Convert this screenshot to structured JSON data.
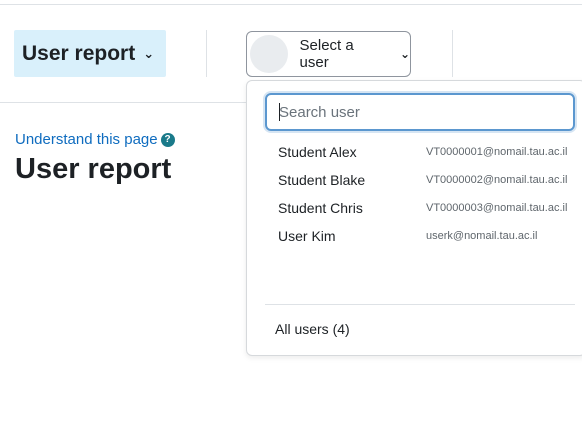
{
  "header": {
    "report_selector_label": "User report",
    "user_selector_label": "Select a user"
  },
  "help": {
    "link_text": "Understand this page",
    "icon": "question-circle-icon"
  },
  "page_title": "User report",
  "user_dropdown": {
    "search_placeholder": "Search user",
    "users": [
      {
        "name": "Student Alex",
        "email": "VT0000001@nomail.tau.ac.il"
      },
      {
        "name": "Student Blake",
        "email": "VT0000002@nomail.tau.ac.il"
      },
      {
        "name": "Student Chris",
        "email": "VT0000003@nomail.tau.ac.il"
      },
      {
        "name": "User Kim",
        "email": "userk@nomail.tau.ac.il"
      }
    ],
    "all_users_label": "All users (4)"
  },
  "colors": {
    "report_selector_bg": "#d9f0fb",
    "link": "#0f6cbf",
    "focus_border": "#5b97cf"
  }
}
